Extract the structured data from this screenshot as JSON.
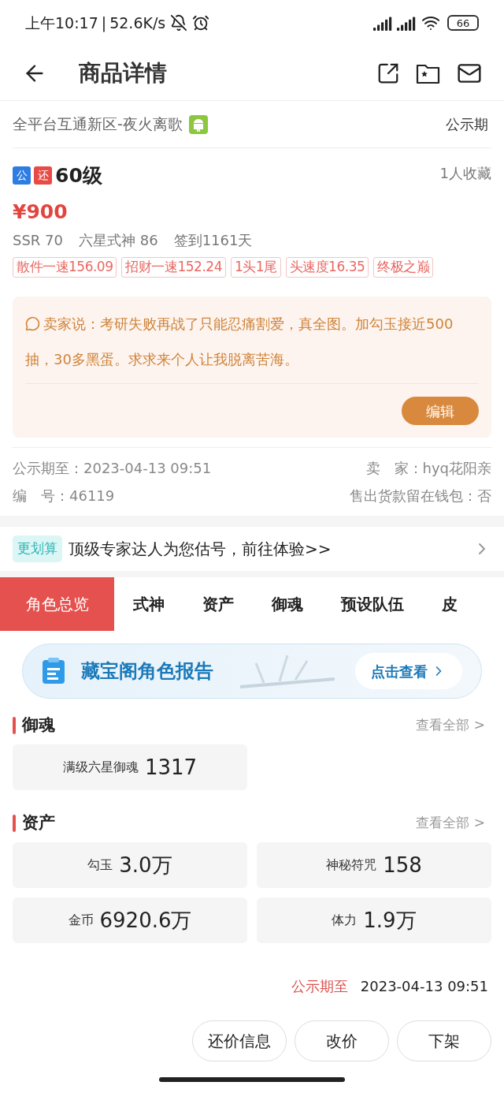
{
  "status_bar": {
    "time": "上午10:17",
    "separator": "|",
    "speed": "52.6K/s",
    "battery": "66"
  },
  "header": {
    "title": "商品详情"
  },
  "server": {
    "name": "全平台互通新区-夜火离歌",
    "status": "公示期"
  },
  "item": {
    "badges": [
      {
        "text": "公",
        "color": "#2f7de1"
      },
      {
        "text": "还",
        "color": "#e84a45"
      }
    ],
    "level": "60级",
    "favorites": "1人收藏",
    "price": "¥900",
    "stats": [
      "SSR 70",
      "六星式神 86",
      "签到1161天"
    ],
    "tags": [
      "散件一速156.09",
      "招财一速152.24",
      "1头1尾",
      "头速度16.35",
      "终极之巅"
    ]
  },
  "seller_note": {
    "text": "卖家说：考研失败再战了只能忍痛割爱，真全图。加勾玉接近500抽，30多黑蛋。求求来个人让我脱离苦海。",
    "button": "编辑"
  },
  "info": [
    {
      "label": "公示期至：",
      "value": "2023-04-13 09:51"
    },
    {
      "label": "卖　家：",
      "value": "hyq花阳亲"
    },
    {
      "label": "编　号：",
      "value": "46119"
    },
    {
      "label": "售出货款留在钱包：",
      "value": "否"
    }
  ],
  "promo": {
    "badge": "更划算",
    "text": "顶级专家达人为您估号，前往体验>>"
  },
  "tabs": [
    {
      "label": "角色总览",
      "selected": true
    },
    {
      "label": "式神",
      "selected": false
    },
    {
      "label": "资产",
      "selected": false
    },
    {
      "label": "御魂",
      "selected": false
    },
    {
      "label": "预设队伍",
      "selected": false
    },
    {
      "label": "皮",
      "selected": false
    }
  ],
  "report_banner": {
    "title": "藏宝阁角色报告",
    "button": "点击查看"
  },
  "sections": [
    {
      "title": "御魂",
      "link": "查看全部 >",
      "cards": [
        {
          "label": "满级六星御魂",
          "value": "1317"
        }
      ]
    },
    {
      "title": "资产",
      "link": "查看全部 >",
      "cards": [
        {
          "label": "勾玉",
          "value": "3.0万"
        },
        {
          "label": "神秘符咒",
          "value": "158"
        },
        {
          "label": "金币",
          "value": "6920.6万"
        },
        {
          "label": "体力",
          "value": "1.9万"
        }
      ]
    }
  ],
  "footer": {
    "deadline_label": "公示期至",
    "deadline": "2023-04-13 09:51",
    "buttons": [
      "还价信息",
      "改价",
      "下架"
    ]
  }
}
